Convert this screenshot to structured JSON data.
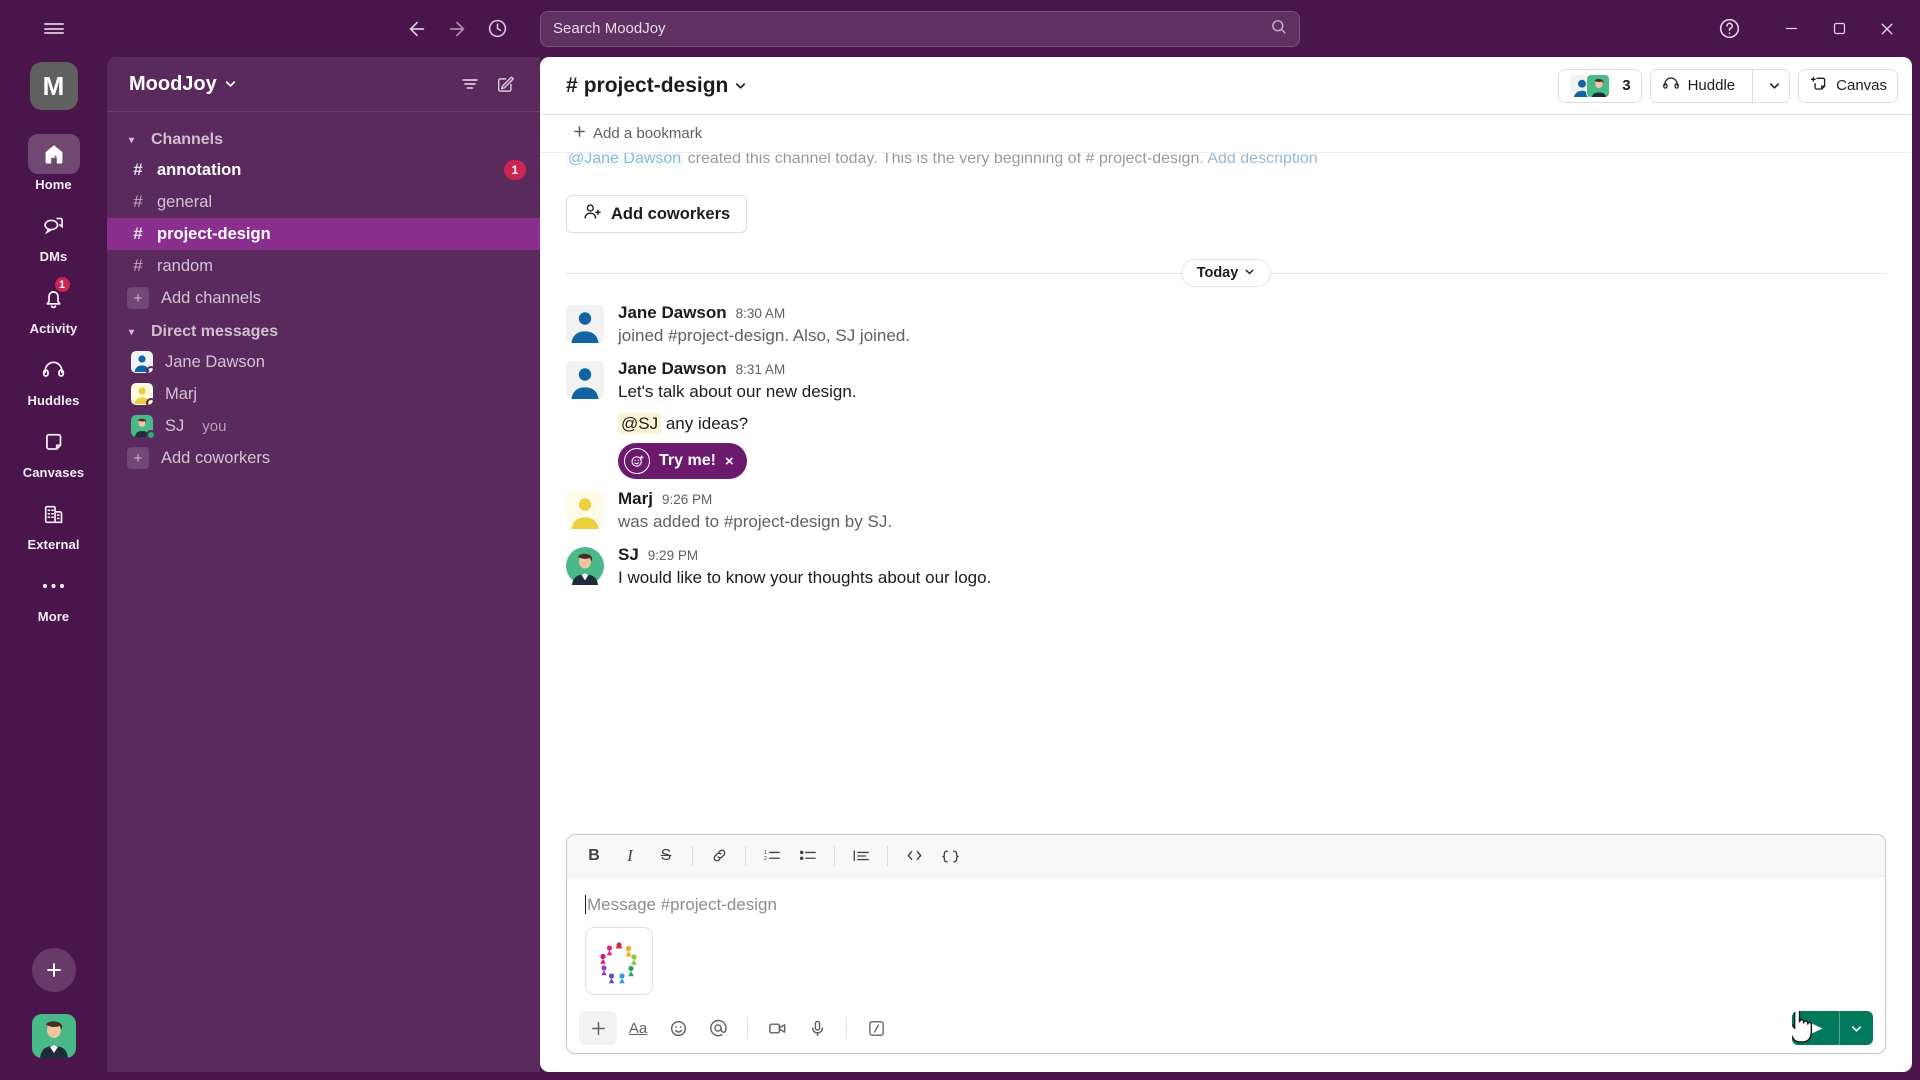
{
  "titlebar": {
    "hamburger_icon": "hamburger-icon",
    "back_icon": "arrow-left-icon",
    "forward_icon": "arrow-right-icon",
    "history_icon": "clock-icon",
    "search_placeholder": "Search MoodJoy",
    "search_icon": "search-icon",
    "help_icon": "help-circle-icon",
    "minimize_icon": "minimize-icon",
    "maximize_icon": "maximize-icon",
    "close_icon": "close-icon"
  },
  "rail": {
    "workspace_initial": "M",
    "items": [
      {
        "label": "Home",
        "icon": "home-icon",
        "active": true,
        "badge": ""
      },
      {
        "label": "DMs",
        "icon": "chat-bubbles-icon",
        "active": false,
        "badge": ""
      },
      {
        "label": "Activity",
        "icon": "bell-icon",
        "active": false,
        "badge": "1"
      },
      {
        "label": "Huddles",
        "icon": "headphones-icon",
        "active": false,
        "badge": ""
      },
      {
        "label": "Canvases",
        "icon": "canvas-icon",
        "active": false,
        "badge": ""
      },
      {
        "label": "External",
        "icon": "building-icon",
        "active": false,
        "badge": ""
      },
      {
        "label": "More",
        "icon": "ellipsis-icon",
        "active": false,
        "badge": ""
      }
    ],
    "new_button_icon": "plus-icon",
    "avatar_name": "user-avatar"
  },
  "sidebar": {
    "workspace_name": "MoodJoy",
    "workspace_caret": "⌄",
    "filter_icon": "filter-icon",
    "compose_icon": "compose-icon",
    "sections": [
      {
        "label": "Channels",
        "caret": "▾",
        "items": [
          {
            "name": "annotation",
            "type": "channel",
            "unread": true,
            "active": false,
            "badge": "1"
          },
          {
            "name": "general",
            "type": "channel",
            "unread": false,
            "active": false,
            "badge": ""
          },
          {
            "name": "project-design",
            "type": "channel",
            "unread": false,
            "active": true,
            "badge": ""
          },
          {
            "name": "random",
            "type": "channel",
            "unread": false,
            "active": false,
            "badge": ""
          },
          {
            "name": "Add channels",
            "type": "add",
            "unread": false,
            "active": false,
            "badge": ""
          }
        ]
      },
      {
        "label": "Direct messages",
        "caret": "▾",
        "items": [
          {
            "name": "Jane Dawson",
            "type": "dm",
            "avatar": "jane",
            "presence": "away",
            "you": ""
          },
          {
            "name": "Marj",
            "type": "dm",
            "avatar": "marj",
            "presence": "away",
            "you": ""
          },
          {
            "name": "SJ",
            "type": "dm",
            "avatar": "sj",
            "presence": "online",
            "you": "you"
          },
          {
            "name": "Add coworkers",
            "type": "add",
            "avatar": "",
            "presence": "",
            "you": ""
          }
        ]
      }
    ]
  },
  "main_header": {
    "channel_prefix": "#",
    "channel_name": "project-design",
    "caret": "⌄",
    "members_count": "3",
    "huddle_label": "Huddle",
    "huddle_icon": "headphones-icon",
    "huddle_caret": "⌄",
    "canvas_label": "Canvas",
    "canvas_icon": "canvas-plus-icon"
  },
  "bookmark_bar": {
    "add_bookmark_label": "Add a bookmark",
    "plus_icon": "plus-icon"
  },
  "intro": {
    "creator": "@Jane Dawson",
    "text": " created this channel today. This is the very beginning of ",
    "channel": "# project-design",
    "link": ". Add description",
    "add_coworkers_label": "Add coworkers",
    "add_coworkers_icon": "person-plus-icon"
  },
  "day_divider": {
    "label": "Today",
    "caret": "⌄"
  },
  "messages": [
    {
      "author": "Jane Dawson",
      "time": "8:30 AM",
      "avatar": "jane",
      "text": "joined #project-design. Also, SJ joined.",
      "system": true
    },
    {
      "author": "Jane Dawson",
      "time": "8:31 AM",
      "avatar": "jane",
      "text": "Let's talk about our new design.",
      "system": false,
      "sub_mention": "@SJ",
      "sub_text": " any ideas?",
      "tryme_label": "Try me!",
      "tryme_close": "×",
      "tryme_emoji_icon": "emoji-plus-icon"
    },
    {
      "author": "Marj",
      "time": "9:26 PM",
      "avatar": "marj",
      "text": "was added to #project-design by SJ.",
      "system": true
    },
    {
      "author": "SJ",
      "time": "9:29 PM",
      "avatar": "sj",
      "text": "I would like to know your thoughts about our logo.",
      "system": false
    }
  ],
  "composer": {
    "placeholder": "Message #project-design",
    "format_buttons": [
      {
        "name": "bold-icon",
        "glyph": "B"
      },
      {
        "name": "italic-icon",
        "glyph": "I"
      },
      {
        "name": "strikethrough-icon",
        "glyph": "S"
      },
      {
        "name": "link-icon",
        "glyph": "link"
      },
      {
        "name": "ordered-list-icon",
        "glyph": "ol"
      },
      {
        "name": "bulleted-list-icon",
        "glyph": "ul"
      },
      {
        "name": "blockquote-icon",
        "glyph": "bq"
      },
      {
        "name": "code-icon",
        "glyph": "</>"
      },
      {
        "name": "code-block-icon",
        "glyph": "cb"
      }
    ],
    "action_buttons": [
      {
        "name": "plus-icon",
        "glyph": "+"
      },
      {
        "name": "text-format-icon",
        "glyph": "Aa"
      },
      {
        "name": "emoji-icon",
        "glyph": "emoji"
      },
      {
        "name": "mention-icon",
        "glyph": "@"
      },
      {
        "name": "video-icon",
        "glyph": "video"
      },
      {
        "name": "microphone-icon",
        "glyph": "mic"
      },
      {
        "name": "slash-command-icon",
        "glyph": "slash"
      }
    ],
    "attachment_name": "logo-thumbnail",
    "send_icon": "send-icon",
    "send_caret": "⌄",
    "send_color": "#007A5A"
  },
  "colors": {
    "brand_purple": "#4A154B",
    "sidebar_purple": "#5A2A5C",
    "active_channel": "#8B2F8F",
    "badge_red": "#CD2553",
    "send_green": "#007A5A",
    "tryme_purple": "#6B1A6E"
  }
}
